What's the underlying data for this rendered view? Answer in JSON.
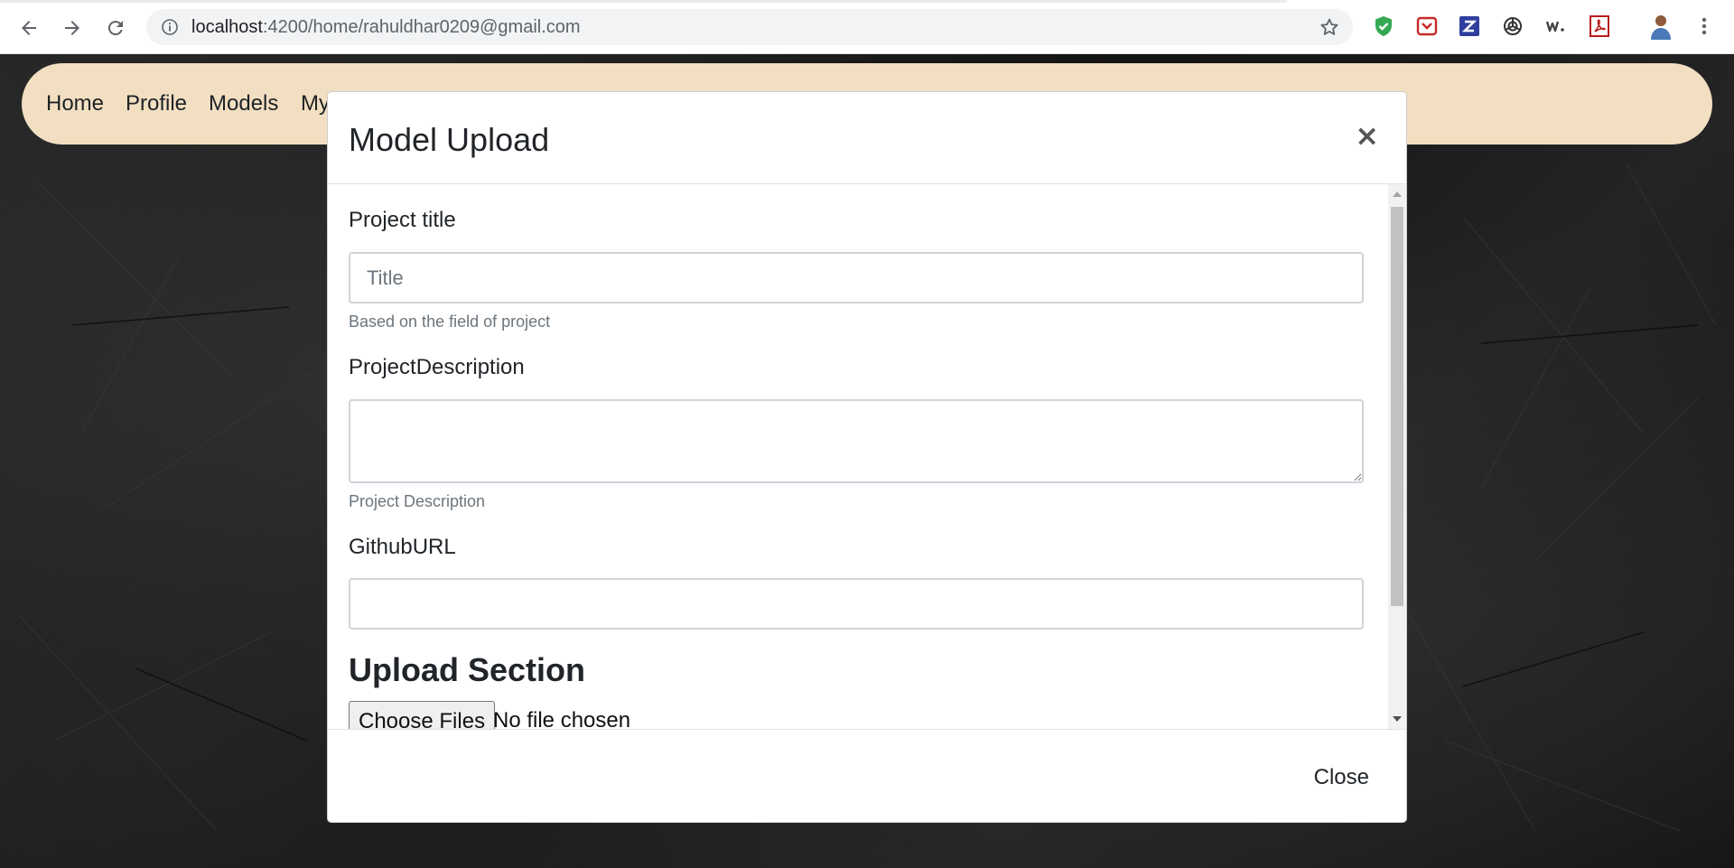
{
  "browser": {
    "url_host": "localhost",
    "url_path": ":4200/home/rahuldhar0209@gmail.com",
    "extensions": [
      "shield-check-icon",
      "pocket-icon",
      "zotero-icon",
      "chatgpt-icon",
      "wordtune-icon",
      "pdf-icon",
      "profile-avatar",
      "more-icon"
    ]
  },
  "navbar": {
    "background": "#ffebcd",
    "links": [
      "Home",
      "Profile",
      "Models",
      "My"
    ]
  },
  "modal": {
    "title": "Model Upload",
    "close_symbol": "×",
    "fields": {
      "title_label": "Project title",
      "title_placeholder": "Title",
      "title_help": "Based on the field of project",
      "desc_label": "ProjectDescription",
      "desc_help": "Project Description",
      "github_label": "GithubURL"
    },
    "upload": {
      "heading": "Upload Section",
      "button": "Choose Files",
      "status": "No file chosen"
    },
    "footer_close": "Close"
  }
}
